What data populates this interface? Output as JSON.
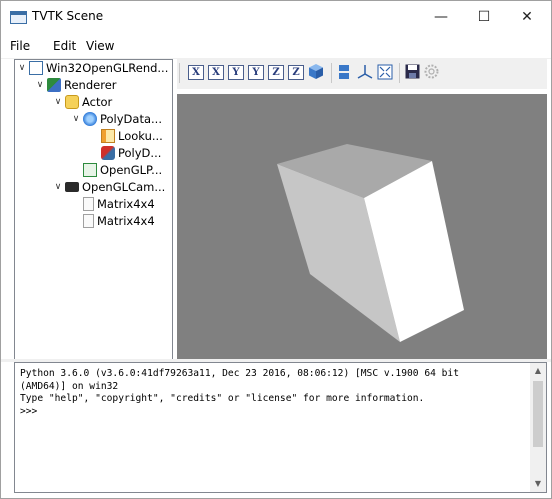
{
  "window": {
    "title": "TVTK Scene",
    "minimize": "—",
    "maximize": "☐",
    "close": "✕"
  },
  "menu": {
    "items": [
      "File",
      "Edit",
      "View"
    ]
  },
  "tree": {
    "nodes": [
      {
        "label": "Win32OpenGLRend...",
        "icon": "window-icon",
        "expander": "∨"
      },
      {
        "label": "Renderer",
        "icon": "renderer-icon",
        "expander": "∨"
      },
      {
        "label": "Actor",
        "icon": "actor-icon",
        "expander": "∨"
      },
      {
        "label": "PolyData...",
        "icon": "polydata-icon",
        "expander": "∨"
      },
      {
        "label": "Looku...",
        "icon": "lookup-table-icon",
        "expander": ""
      },
      {
        "label": "PolyD...",
        "icon": "polydata-mapper-icon",
        "expander": ""
      },
      {
        "label": "OpenGLP...",
        "icon": "property-icon",
        "expander": ""
      },
      {
        "label": "OpenGLCam...",
        "icon": "camera-icon",
        "expander": "∨"
      },
      {
        "label": "Matrix4x4",
        "icon": "document-icon",
        "expander": ""
      },
      {
        "label": "Matrix4x4",
        "icon": "document-icon",
        "expander": ""
      }
    ]
  },
  "toolbar": {
    "view_buttons": [
      "X",
      "X",
      "Y",
      "Y",
      "Z",
      "Z"
    ],
    "icons": [
      "view-iso-icon",
      "parallel-projection-icon",
      "axes-icon",
      "fullscreen-icon",
      "save-icon",
      "settings-icon"
    ]
  },
  "console": {
    "text": "Python 3.6.0 (v3.6.0:41df79263a11, Dec 23 2016, 08:06:12) [MSC v.1900 64 bit\n(AMD64)] on win32\nType \"help\", \"copyright\", \"credits\" or \"license\" for more information.\n>>>"
  },
  "colors": {
    "viewport_bg": "#808080",
    "accent": "#3a6ea5"
  }
}
